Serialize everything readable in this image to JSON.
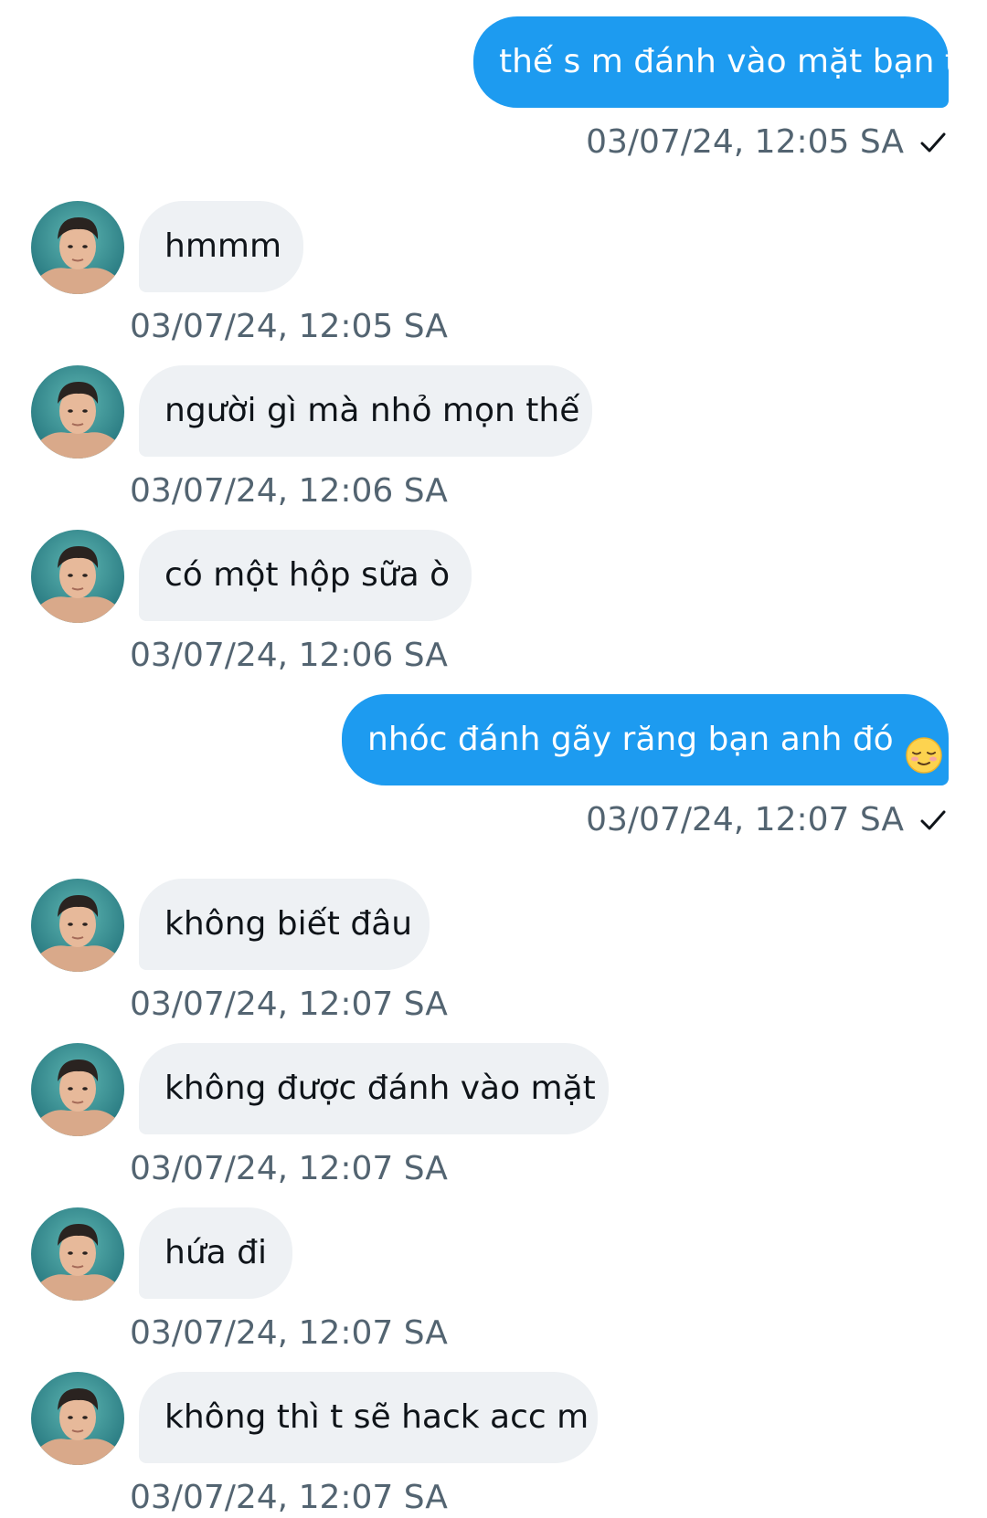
{
  "messages": [
    {
      "dir": "sent",
      "text": "thế s m đánh vào mặt bạn t",
      "time": "03/07/24, 12:05 SA",
      "icon": "check-icon"
    },
    {
      "dir": "recv",
      "text": "hmmm",
      "time": "03/07/24, 12:05 SA",
      "icon": "avatar"
    },
    {
      "dir": "recv",
      "text": "người gì mà nhỏ mọn thế",
      "time": "03/07/24, 12:06 SA",
      "icon": "avatar"
    },
    {
      "dir": "recv",
      "text": "có một hộp sữa ò",
      "time": "03/07/24, 12:06 SA",
      "icon": "avatar"
    },
    {
      "dir": "sent",
      "text": "nhóc đánh gãy răng bạn anh đó",
      "time": "03/07/24, 12:07 SA",
      "emoji": "relieved-face-emoji",
      "icon": "check-icon"
    },
    {
      "dir": "recv",
      "text": "không biết đâu",
      "time": "03/07/24, 12:07 SA",
      "icon": "avatar"
    },
    {
      "dir": "recv",
      "text": "không được đánh vào mặt",
      "time": "03/07/24, 12:07 SA",
      "icon": "avatar"
    },
    {
      "dir": "recv",
      "text": "hứa đi",
      "time": "03/07/24, 12:07 SA",
      "icon": "avatar"
    },
    {
      "dir": "recv",
      "text": "không thì t sẽ hack acc m",
      "time": "03/07/24, 12:07 SA",
      "icon": "avatar"
    }
  ],
  "colors": {
    "sent_bubble": "#1d9bf0",
    "received_bubble": "#eef1f4",
    "timestamp": "#536471",
    "received_text": "#0f1419"
  }
}
